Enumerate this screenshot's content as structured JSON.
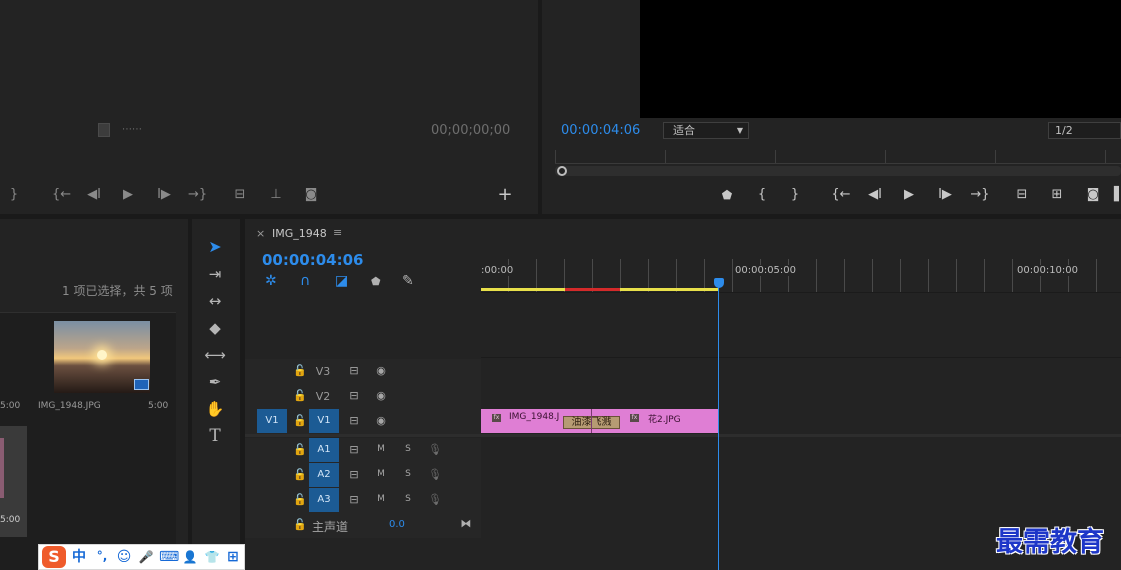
{
  "source_monitor": {
    "timecode": "00;00;00;00",
    "controls": [
      "mark-out",
      "go-to-in",
      "step-back",
      "play",
      "step-forward",
      "go-to-out",
      "insert",
      "overwrite",
      "export-frame"
    ],
    "add_button": "+"
  },
  "program_monitor": {
    "timecode": "00:00:04:06",
    "fit_select": "适合",
    "resolution_select": "1/2",
    "controls": [
      "add-marker",
      "mark-in",
      "mark-out",
      "go-to-in",
      "step-back",
      "play",
      "step-forward",
      "go-to-out",
      "lift",
      "extract",
      "export-frame"
    ]
  },
  "project_panel": {
    "selection_status": "1 项已选择，共 5 项",
    "items": [
      {
        "name": "IMG_1948.JPG",
        "duration": "5:00"
      }
    ],
    "left_cut_duration": "5:00",
    "left_cut_duration_2": "5:00"
  },
  "tools": [
    "selection-tool",
    "track-select-forward-tool",
    "ripple-edit-tool",
    "razor-tool",
    "slip-tool",
    "pen-tool",
    "hand-tool",
    "type-tool"
  ],
  "timeline": {
    "tab_close": "×",
    "sequence_name": "IMG_1948",
    "tab_menu": "≡",
    "timecode": "00:00:04:06",
    "ruler": [
      ":00:00",
      "00:00:05:00",
      "00:00:10:00"
    ],
    "video_tracks": [
      {
        "name": "V3",
        "source": ""
      },
      {
        "name": "V2",
        "source": ""
      },
      {
        "name": "V1",
        "source": "V1"
      }
    ],
    "audio_tracks": [
      {
        "name": "A1",
        "m": "M",
        "s": "S"
      },
      {
        "name": "A2",
        "m": "M",
        "s": "S"
      },
      {
        "name": "A3",
        "m": "M",
        "s": "S"
      }
    ],
    "master": {
      "label": "主声道",
      "value": "0.0"
    },
    "clips": {
      "clip1": "IMG_1948.J",
      "transition": "油漆飞溅",
      "clip2": "花2.JPG",
      "fx": "fx"
    }
  },
  "ime_toolbar": {
    "logo": "S",
    "items": [
      "中",
      "°,",
      "☺",
      "🎤",
      "⌨",
      "👤",
      "👕",
      "⊞"
    ]
  },
  "watermark": "最需教育",
  "colors": {
    "accent": "#2d8ceb",
    "clip": "#df7ed4",
    "track_target": "#1c5b94",
    "work_area": "#e8e04a",
    "render_red": "#d42a2a"
  }
}
